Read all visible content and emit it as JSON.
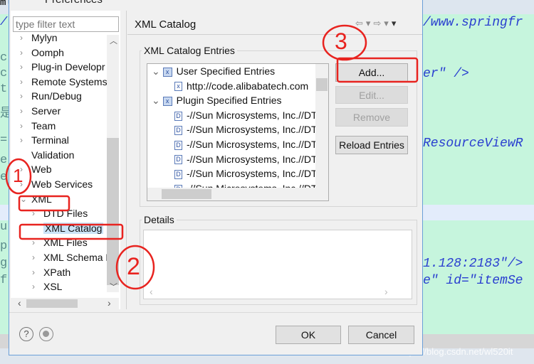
{
  "editor": {
    "left_fragments": [
      "ml",
      "/",
      "c",
      "c",
      "t",
      "是",
      "=",
      "e",
      "e",
      "ul",
      "p",
      "g",
      "f"
    ],
    "right_lines": [
      "/www.springfr",
      "er\" />",
      "ResourceViewR",
      "1.128:2183\"/>",
      "e\" id=\"itemSe"
    ],
    "watermark": "https://blog.csdn.net/wl520it"
  },
  "dialog": {
    "title": "Preferences",
    "filter_placeholder": "type filter text",
    "tree": [
      {
        "label": "Mylyn",
        "expand": "collapsed"
      },
      {
        "label": "Oomph",
        "expand": "collapsed"
      },
      {
        "label": "Plug-in Developr",
        "expand": "collapsed"
      },
      {
        "label": "Remote Systems",
        "expand": "collapsed"
      },
      {
        "label": "Run/Debug",
        "expand": "collapsed"
      },
      {
        "label": "Server",
        "expand": "collapsed"
      },
      {
        "label": "Team",
        "expand": "collapsed"
      },
      {
        "label": "Terminal",
        "expand": "collapsed"
      },
      {
        "label": "Validation",
        "expand": "none"
      },
      {
        "label": "Web",
        "expand": "collapsed"
      },
      {
        "label": "Web Services",
        "expand": "collapsed"
      },
      {
        "label": "XML",
        "expand": "expanded"
      },
      {
        "label": "DTD Files",
        "expand": "collapsed",
        "child": true
      },
      {
        "label": "XML Catalog",
        "expand": "none",
        "child": true,
        "selected": true
      },
      {
        "label": "XML Files",
        "expand": "collapsed",
        "child": true
      },
      {
        "label": "XML Schema F",
        "expand": "collapsed",
        "child": true
      },
      {
        "label": "XPath",
        "expand": "collapsed",
        "child": true
      },
      {
        "label": "XSL",
        "expand": "collapsed",
        "child": true
      }
    ],
    "page_title": "XML Catalog",
    "entries_group": "XML Catalog Entries",
    "entries": [
      {
        "label": "User Specified Entries",
        "level": 0,
        "icon": "catalog-icon"
      },
      {
        "label": "http://code.alibabatech.com",
        "level": 1,
        "icon": "xml-file-icon"
      },
      {
        "label": "Plugin Specified Entries",
        "level": 0,
        "icon": "catalog-icon"
      },
      {
        "label": "-//Sun Microsystems, Inc.//DTD",
        "level": 1,
        "icon": "dtd-icon"
      },
      {
        "label": "-//Sun Microsystems, Inc.//DTD",
        "level": 1,
        "icon": "dtd-icon"
      },
      {
        "label": "-//Sun Microsystems, Inc.//DTD",
        "level": 1,
        "icon": "dtd-icon"
      },
      {
        "label": "-//Sun Microsystems, Inc.//DTD",
        "level": 1,
        "icon": "dtd-icon"
      },
      {
        "label": "-//Sun Microsystems, Inc.//DTD",
        "level": 1,
        "icon": "dtd-icon"
      },
      {
        "label": "-//Sun Microsystems, Inc.//DTD",
        "level": 1,
        "icon": "dtd-icon"
      }
    ],
    "buttons": {
      "add": "Add...",
      "edit": "Edit...",
      "remove": "Remove",
      "reload": "Reload Entries"
    },
    "details_group": "Details",
    "ok": "OK",
    "cancel": "Cancel"
  },
  "annotations": {
    "color": "#e8231f",
    "marks": [
      "1",
      "2",
      "3"
    ]
  }
}
